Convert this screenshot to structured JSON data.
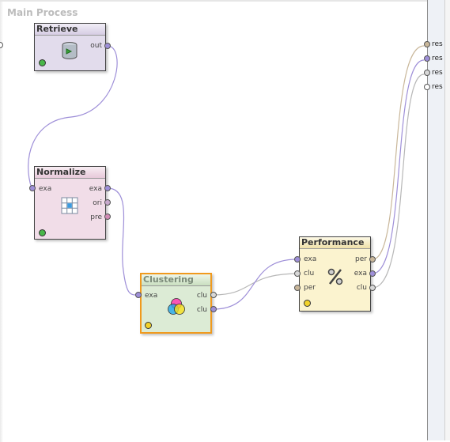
{
  "process": {
    "title": "Main Process"
  },
  "operators": {
    "retrieve": {
      "title": "Retrieve",
      "ports_out": [
        "out"
      ]
    },
    "normalize": {
      "title": "Normalize",
      "ports_in": [
        "exa"
      ],
      "ports_out": [
        "exa",
        "ori",
        "pre"
      ]
    },
    "clustering": {
      "title": "Clustering",
      "ports_in": [
        "exa"
      ],
      "ports_out": [
        "clu",
        "clu"
      ]
    },
    "performance": {
      "title": "Performance",
      "ports_in": [
        "exa",
        "clu",
        "per"
      ],
      "ports_out": [
        "per",
        "exa",
        "clu"
      ]
    }
  },
  "results": [
    "res",
    "res",
    "res",
    "res"
  ],
  "colors": {
    "retrieve_bg": "#e2dcec",
    "normalize_bg": "#f1dde8",
    "clustering_bg": "#dcebd5",
    "performance_bg": "#fbf3cf",
    "wire_example": "#9e8fd8",
    "wire_gray": "#b7b7b7",
    "wire_perf": "#c9b79a"
  },
  "icons": [
    "database-icon",
    "grid-icon",
    "clustering-circles-icon",
    "percent-icon"
  ]
}
